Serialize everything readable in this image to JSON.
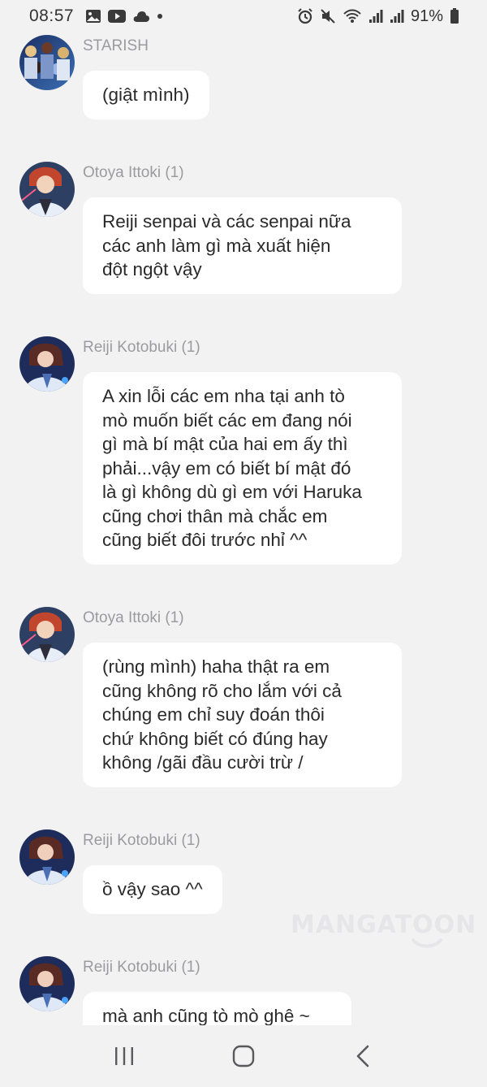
{
  "status_bar": {
    "time": "08:57",
    "battery": "91%",
    "left_icons": [
      "gallery-icon",
      "youtube-icon",
      "cloud-icon",
      "dot-icon"
    ],
    "right_icons": [
      "alarm-icon",
      "mute-icon",
      "wifi-icon",
      "signal-icon",
      "signal-icon",
      "battery-icon"
    ]
  },
  "messages": [
    {
      "sender": "STARISH",
      "text": "(giật mình)",
      "avatar": "group-avatar"
    },
    {
      "sender": "Otoya Ittoki (1)",
      "text": "Reiji senpai và các senpai nữa\ncác anh làm gì mà xuất hiện\nđột ngột vậy",
      "avatar": "otoya-avatar"
    },
    {
      "sender": "Reiji Kotobuki (1)",
      "text": "A xin lỗi các em nha tại anh tò\nmò muốn biết các em đang nói\ngì mà bí mật của hai em ấy thì\nphải...vậy em có biết bí mật đó\nlà gì không dù gì em với Haruka\ncũng chơi thân mà chắc em\ncũng biết đôi trước nhỉ ^^",
      "avatar": "reiji-avatar"
    },
    {
      "sender": "Otoya Ittoki (1)",
      "text": "(rùng mình) haha thật ra em\ncũng không rõ cho lắm với cả\nchúng em chỉ suy đoán thôi\nchứ không biết có đúng hay\nkhông /gãi đầu cười trừ /",
      "avatar": "otoya-avatar"
    },
    {
      "sender": "Reiji Kotobuki (1)",
      "text": "ồ vậy sao ^^",
      "avatar": "reiji-avatar"
    },
    {
      "sender": "Reiji Kotobuki (1)",
      "text": "mà anh cũng tò mò ghê ~",
      "avatar": "reiji-avatar"
    }
  ],
  "watermark": "MANGATOON",
  "nav": {
    "icons": [
      "recent-apps-icon",
      "home-icon",
      "back-icon"
    ]
  }
}
